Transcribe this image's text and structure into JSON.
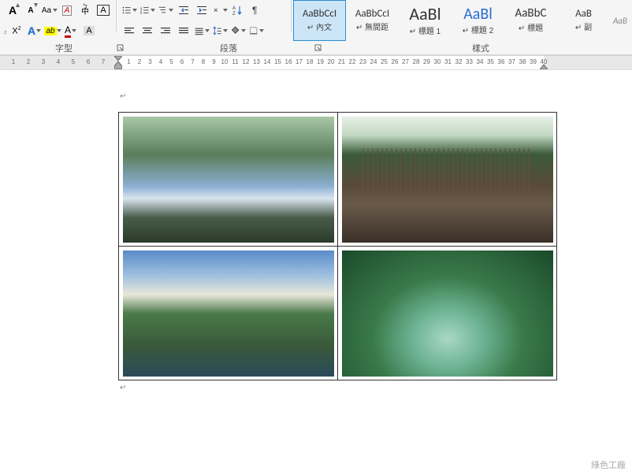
{
  "ribbon": {
    "font_group_label": "字型",
    "paragraph_group_label": "段落",
    "styles_group_label": "樣式",
    "font_buttons": {
      "grow": "A",
      "shrink": "A",
      "change_case": "Aa",
      "clear_format": "A",
      "phonetic": "中",
      "char_border": "A",
      "superscript": "X²",
      "subscript": "X₂",
      "text_effects": "A",
      "highlight": "ab",
      "font_color": "A",
      "char_shading": "A"
    },
    "styles": [
      {
        "preview": "AaBbCcI",
        "name": "內文",
        "size": "13px",
        "selected": true
      },
      {
        "preview": "AaBbCcI",
        "name": "無間距",
        "size": "13px",
        "selected": false
      },
      {
        "preview": "AaBl",
        "name": "標題 1",
        "size": "22px",
        "selected": false
      },
      {
        "preview": "AaBl",
        "name": "標題 2",
        "size": "20px",
        "selected": false
      },
      {
        "preview": "AaBbC",
        "name": "標題",
        "size": "15px",
        "selected": false
      },
      {
        "preview": "AaB",
        "name": "副",
        "size": "13px",
        "selected": false
      }
    ],
    "style_more": "AaB"
  },
  "ruler": {
    "left_numbers": [
      "7",
      "6",
      "5",
      "4",
      "3",
      "2",
      "1"
    ],
    "right_numbers": [
      "1",
      "2",
      "3",
      "4",
      "5",
      "6",
      "7",
      "8",
      "9",
      "10",
      "11",
      "12",
      "13",
      "14",
      "15",
      "16",
      "17",
      "18",
      "19",
      "20",
      "21",
      "22",
      "23",
      "24",
      "25",
      "26",
      "27",
      "28",
      "29",
      "30",
      "31",
      "32",
      "33",
      "34",
      "35",
      "36",
      "37",
      "38",
      "39",
      "40"
    ]
  },
  "document": {
    "table": {
      "rows": 2,
      "cols": 2,
      "cells": [
        {
          "alt": "river-rocks-photo"
        },
        {
          "alt": "dead-trees-wetland-photo"
        },
        {
          "alt": "coastal-mountain-photo"
        },
        {
          "alt": "mangrove-water-photo"
        }
      ]
    }
  },
  "watermark": "綠色工廠"
}
